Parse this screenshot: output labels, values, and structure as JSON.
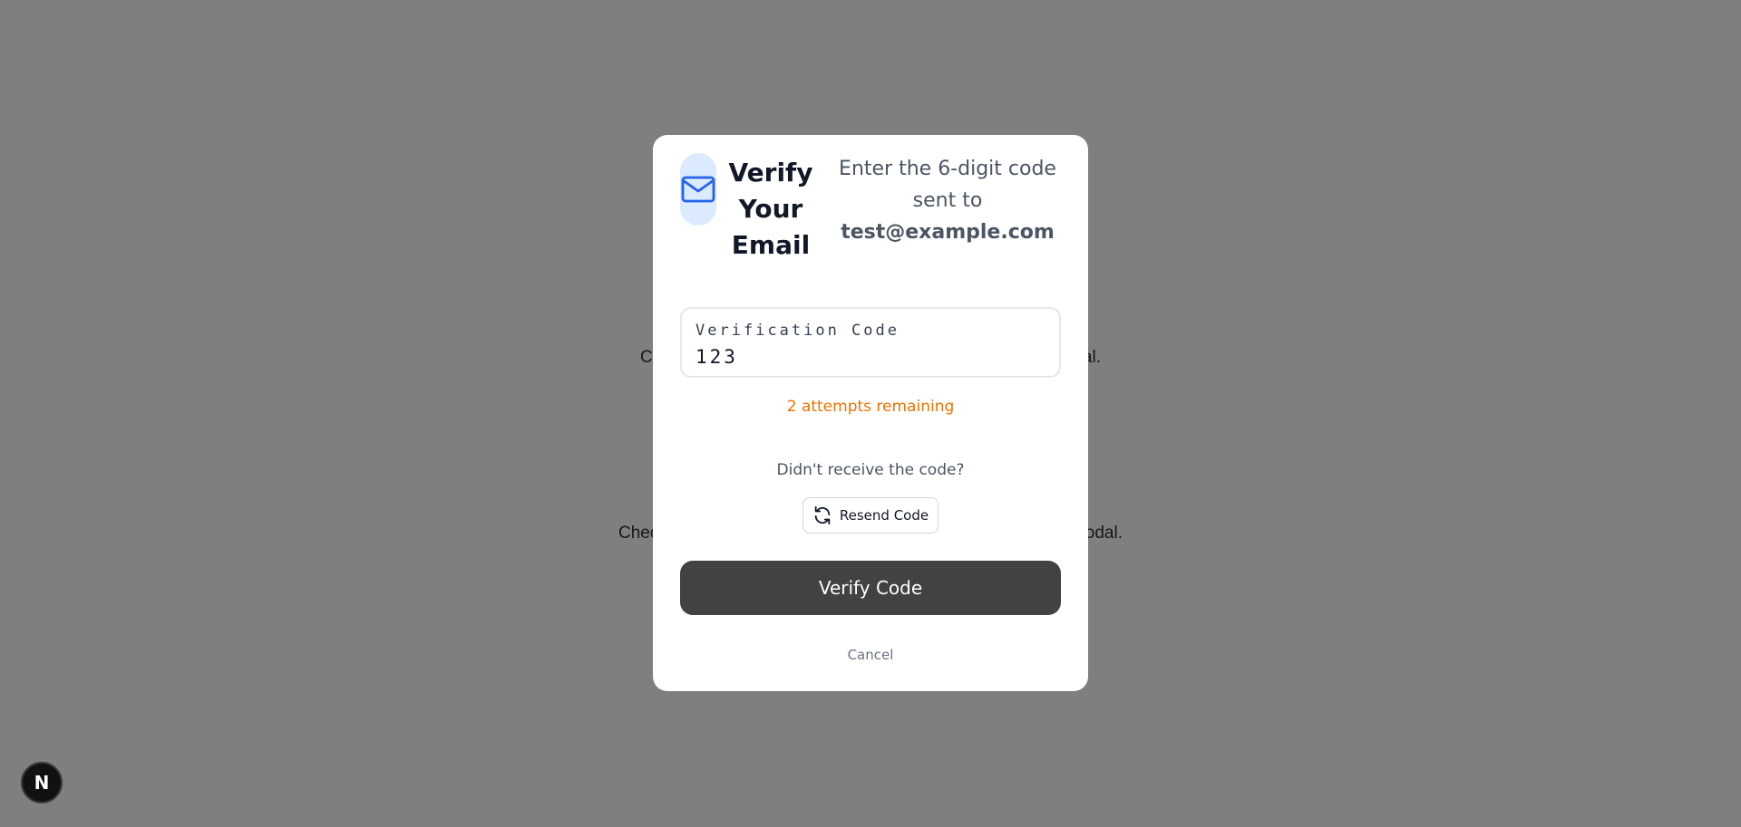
{
  "background": {
    "line1_left": "C",
    "line1_right": "al.",
    "line2_left": "Chec",
    "line2_right": "odal."
  },
  "modal": {
    "title": "Verify Your Email",
    "subtitle": "Enter the 6-digit code sent to",
    "email": "test@example.com",
    "icon": "mail-icon",
    "input": {
      "label": "Verification Code",
      "value": "123"
    },
    "attempts_text": "2 attempts remaining",
    "resend_prompt": "Didn't receive the code?",
    "resend_label": "Resend Code",
    "verify_label": "Verify Code",
    "cancel_label": "Cancel"
  },
  "dev_badge": {
    "label": "N"
  },
  "colors": {
    "overlay": "#7f7f7f",
    "icon_bg": "#dbeafe",
    "icon": "#2563eb",
    "attempts": "#ea7300",
    "verify_button": "#424242"
  }
}
